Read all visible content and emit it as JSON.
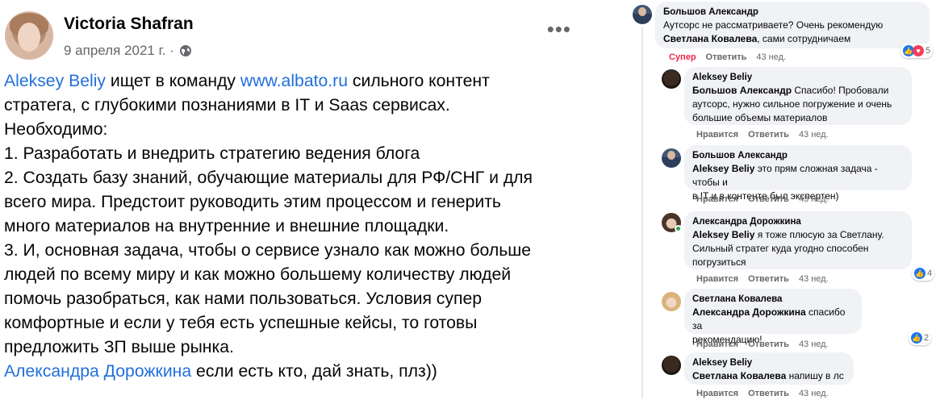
{
  "post": {
    "author": "Victoria Shafran",
    "date": "9 апреля 2021 г. ·",
    "more": "•••",
    "lines": [
      [
        {
          "t": "Aleksey Beliy",
          "link": true
        },
        {
          "t": " ищет в команду "
        },
        {
          "t": "www.albato.ru",
          "link": true
        },
        {
          "t": " сильного контент"
        }
      ],
      [
        {
          "t": "стратега, с глубокими познаниями в IT и Saas сервисах."
        }
      ],
      [
        {
          "t": "Необходимо:"
        }
      ],
      [
        {
          "t": "1. Разработать и внедрить стратегию ведения блога"
        }
      ],
      [
        {
          "t": "2. Создать базу знаний, обучающие материалы для РФ/СНГ и для"
        }
      ],
      [
        {
          "t": "всего мира. Предстоит руководить этим процессом и генерить"
        }
      ],
      [
        {
          "t": "много материалов на внутренние и внешние площадки."
        }
      ],
      [
        {
          "t": "3. И, основная задача, чтобы о сервисе узнало как можно больше"
        }
      ],
      [
        {
          "t": "людей по всему миру и как можно большему количеству людей"
        }
      ],
      [
        {
          "t": "помочь разобраться, как нами пользоваться. Условия супер"
        }
      ],
      [
        {
          "t": "комфортные и если у тебя есть успешные кейсы, то готовы"
        }
      ],
      [
        {
          "t": "предложить ЗП выше рынка."
        }
      ],
      [
        {
          "t": "Александра Дорожкина",
          "link": true
        },
        {
          "t": " если есть кто, дай знать, плз))"
        }
      ]
    ]
  },
  "comments": [
    {
      "name": "Большов Александр",
      "text_line1": "Аутсорс не рассматриваете? Очень рекомендую",
      "mention_line2": "Светлана Ковалева",
      "text_line2": ", сами сотрудничаем",
      "reaction": "Супер",
      "reply": "Ответить",
      "time": "43 нед.",
      "react_count": "5"
    },
    {
      "name": "Aleksey Beliy",
      "mention": "Большов Александр",
      "lines": [
        " Спасибо! Пробовали",
        "аутсорс, нужно сильное погружение и очень",
        "большие объемы материалов"
      ],
      "like": "Нравится",
      "reply": "Ответить",
      "time": "43 нед."
    },
    {
      "name": "Большов Александр",
      "mention": "Aleksey Beliy",
      "lines": [
        " это прям сложная задача - чтобы и",
        "в IT и в контенте был экспертен)"
      ],
      "like": "Нравится",
      "reply": "Ответить",
      "time": "43 нед."
    },
    {
      "name": "Александра Дорожкина",
      "mention": "Aleksey Beliy",
      "lines": [
        " я тоже плюсую за Светлану.",
        "Сильный стратег куда угодно способен",
        "погрузиться"
      ],
      "like": "Нравится",
      "reply": "Ответить",
      "time": "43 нед.",
      "react_count": "4"
    },
    {
      "name": "Светлана Ковалева",
      "mention": "Александра Дорожкина",
      "lines": [
        " спасибо за",
        "рекомендацию!"
      ],
      "like": "Нравится",
      "reply": "Ответить",
      "time": "43 нед.",
      "react_count": "2"
    },
    {
      "name": "Aleksey Beliy",
      "mention": "Светлана Ковалева",
      "lines": [
        " напишу в лс"
      ],
      "like": "Нравится",
      "reply": "Ответить",
      "time": "43 нед."
    }
  ],
  "icons": {
    "more": "more-icon",
    "privacy": "globe-icon",
    "like": "like-icon",
    "love": "love-icon"
  },
  "colors": {
    "link": "#216fdb",
    "bubble": "#f0f2f5",
    "meta": "#65676b",
    "super": "#f02849",
    "like": "#1877f2"
  }
}
